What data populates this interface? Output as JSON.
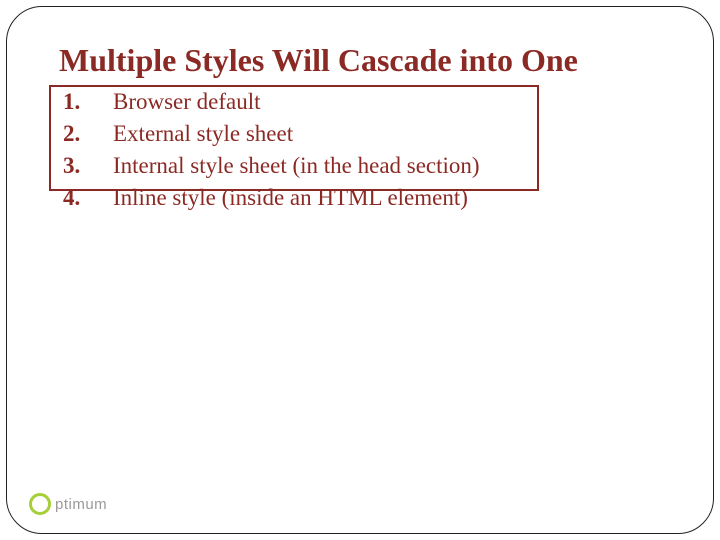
{
  "title": "Multiple Styles Will Cascade into One",
  "list": {
    "items": [
      "Browser default",
      "External style sheet",
      "Internal style sheet (in the head section)",
      "Inline style (inside an HTML element)"
    ]
  },
  "logo": {
    "text": "ptimum"
  }
}
